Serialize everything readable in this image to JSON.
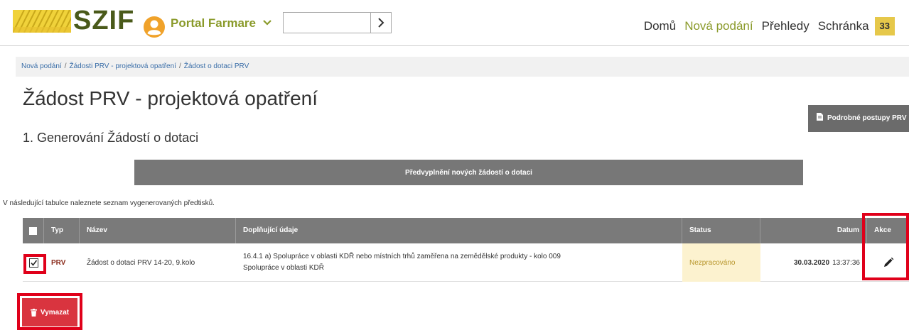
{
  "header": {
    "logo_text": "SZIF",
    "portal_label": "Portal Farmare",
    "search": {
      "value": "",
      "placeholder": ""
    },
    "nav": [
      {
        "label": "Domů",
        "active": false
      },
      {
        "label": "Nová podání",
        "active": true
      },
      {
        "label": "Přehledy",
        "active": false
      },
      {
        "label": "Schránka",
        "active": false
      }
    ],
    "inbox_count": "33"
  },
  "breadcrumb": [
    "Nová podání",
    "Žádosti PRV - projektová opatření",
    "Žádost o dotaci PRV"
  ],
  "page_title": "Žádost PRV - projektová opatření",
  "procedures_button": "Podrobné postupy PRV",
  "section_title": "1. Generování Žádostí o dotaci",
  "prefill_button": "Předvyplnění nových žádostí o dotaci",
  "intro_text": "V následující tabulce naleznete seznam vygenerovaných předtisků.",
  "table": {
    "headers": [
      "Typ",
      "Název",
      "Doplňující údaje",
      "Status",
      "Datum",
      "Akce"
    ],
    "rows": [
      {
        "checked": true,
        "type": "PRV",
        "name": "Žádost o dotaci PRV 14-20, 9.kolo",
        "details_line1": "16.4.1 a) Spolupráce v oblasti KDŘ nebo místních trhů zaměřena na zemědělské produkty - kolo 009",
        "details_line2": "Spolupráce v oblasti KDŘ",
        "status": "Nezpracováno",
        "date": "30.03.2020",
        "time": "13:37:36"
      }
    ]
  },
  "delete_button": "Vymazat",
  "colors": {
    "brand_dark": "#4a5a1a",
    "brand_accent": "#8a9a2a",
    "badge": "#e6c84a",
    "delete": "#d9343f",
    "highlight": "#e0001a",
    "status_bg": "#fcf2cf"
  }
}
